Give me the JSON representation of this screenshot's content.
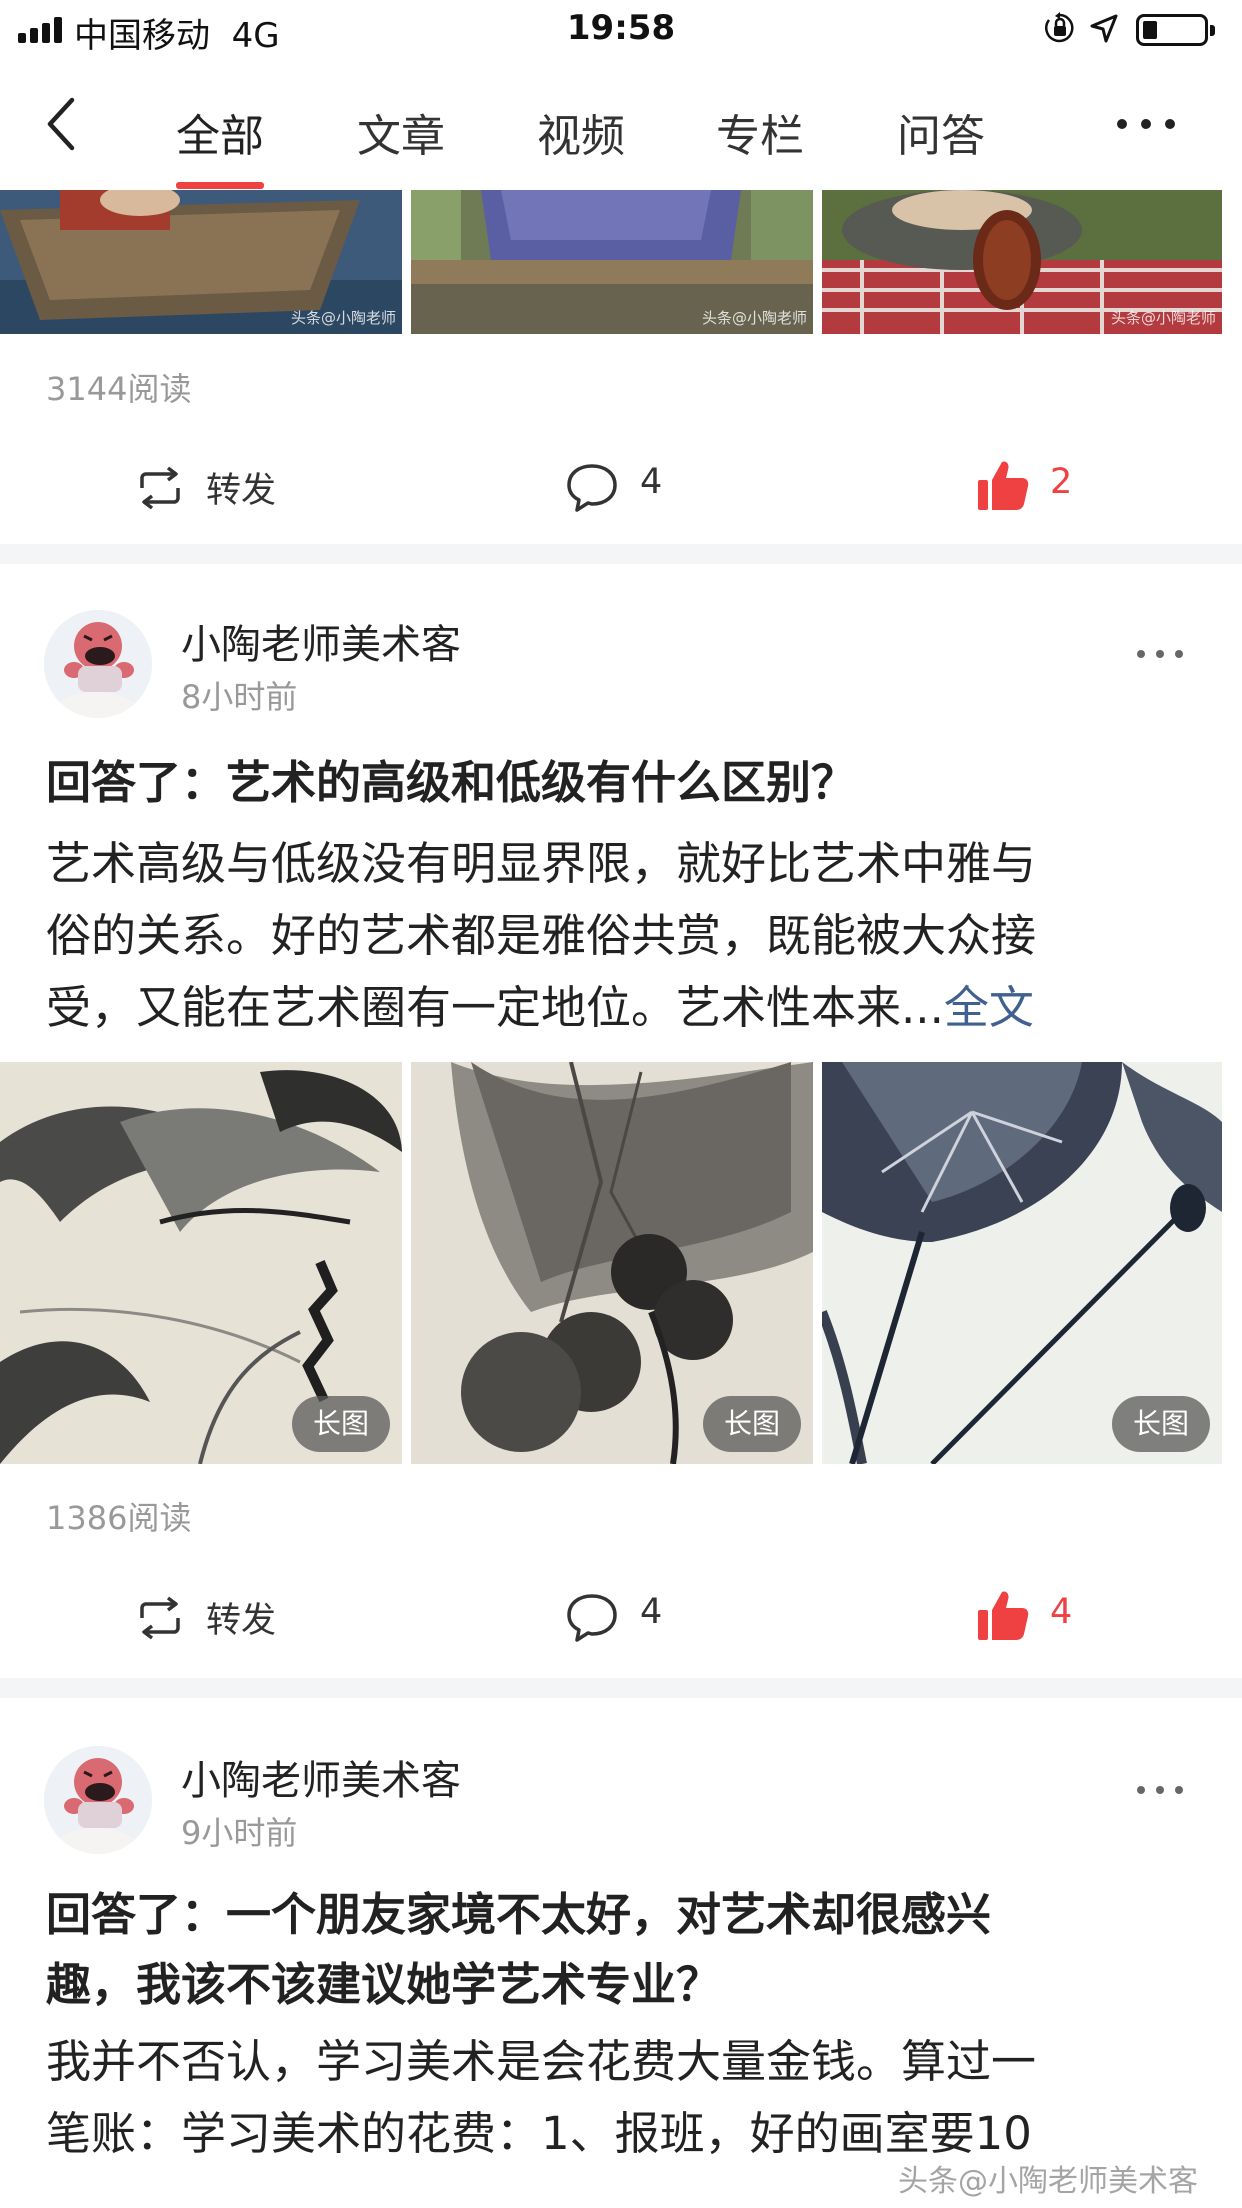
{
  "status_bar": {
    "carrier": "中国移动",
    "network": "4G",
    "time": "19:58"
  },
  "nav": {
    "tabs": [
      {
        "label": "全部",
        "active": true
      },
      {
        "label": "文章",
        "active": false
      },
      {
        "label": "视频",
        "active": false
      },
      {
        "label": "专栏",
        "active": false
      },
      {
        "label": "问答",
        "active": false
      }
    ],
    "accent_color": "#f04142"
  },
  "post0": {
    "image_watermark": "头条@小陶老师",
    "reads": "3144阅读",
    "repost_label": "转发",
    "comments": "4",
    "likes": "2"
  },
  "post1": {
    "author": "小陶老师美术客",
    "time": "8小时前",
    "title": "回答了：艺术的高级和低级有什么区别？",
    "body_lines": [
      "艺术高级与低级没有明显界限，就好比艺术中雅与",
      "俗的关系。好的艺术都是雅俗共赏，既能被大众接",
      "受，又能在艺术圈有一定地位。艺术性本来..."
    ],
    "full_text_link": "全文",
    "image_badges": [
      "长图",
      "长图",
      "长图"
    ],
    "reads": "1386阅读",
    "repost_label": "转发",
    "comments": "4",
    "likes": "4"
  },
  "post2": {
    "author": "小陶老师美术客",
    "time": "9小时前",
    "title_lines": [
      "回答了：一个朋友家境不太好，对艺术却很感兴",
      "趣，我该不该建议她学艺术专业？"
    ],
    "body_lines": [
      "我并不否认，学习美术是会花费大量金钱。算过一",
      "笔账：学习美术的花费：1、报班，好的画室要10"
    ]
  },
  "watermark": "头条@小陶老师美术客"
}
